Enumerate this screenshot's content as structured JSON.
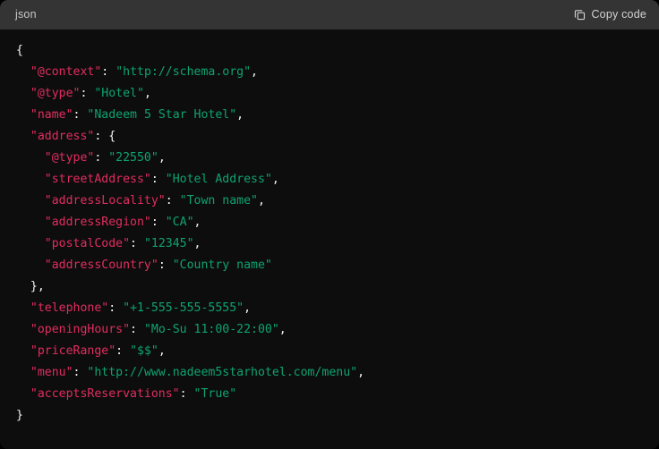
{
  "header": {
    "language_label": "json",
    "copy_label": "Copy code",
    "copy_icon": "copy-code-icon"
  },
  "theme": {
    "header_bg": "#343434",
    "body_bg": "#0d0d0d",
    "punctuation_color": "#f5f5f5",
    "key_color": "#e12d5f",
    "string_color": "#0ea371",
    "label_color": "#c8c8c8"
  },
  "code": {
    "language": "json",
    "lines": [
      {
        "indent": 0,
        "parts": [
          {
            "t": "punc",
            "v": "{"
          }
        ]
      },
      {
        "indent": 1,
        "parts": [
          {
            "t": "key",
            "v": "\"@context\""
          },
          {
            "t": "punc",
            "v": ": "
          },
          {
            "t": "str",
            "v": "\"http://schema.org\""
          },
          {
            "t": "punc",
            "v": ","
          }
        ]
      },
      {
        "indent": 1,
        "parts": [
          {
            "t": "key",
            "v": "\"@type\""
          },
          {
            "t": "punc",
            "v": ": "
          },
          {
            "t": "str",
            "v": "\"Hotel\""
          },
          {
            "t": "punc",
            "v": ","
          }
        ]
      },
      {
        "indent": 1,
        "parts": [
          {
            "t": "key",
            "v": "\"name\""
          },
          {
            "t": "punc",
            "v": ": "
          },
          {
            "t": "str",
            "v": "\"Nadeem 5 Star Hotel\""
          },
          {
            "t": "punc",
            "v": ","
          }
        ]
      },
      {
        "indent": 1,
        "parts": [
          {
            "t": "key",
            "v": "\"address\""
          },
          {
            "t": "punc",
            "v": ": {"
          }
        ]
      },
      {
        "indent": 2,
        "parts": [
          {
            "t": "key",
            "v": "\"@type\""
          },
          {
            "t": "punc",
            "v": ": "
          },
          {
            "t": "str",
            "v": "\"22550\""
          },
          {
            "t": "punc",
            "v": ","
          }
        ]
      },
      {
        "indent": 2,
        "parts": [
          {
            "t": "key",
            "v": "\"streetAddress\""
          },
          {
            "t": "punc",
            "v": ": "
          },
          {
            "t": "str",
            "v": "\"Hotel Address\""
          },
          {
            "t": "punc",
            "v": ","
          }
        ]
      },
      {
        "indent": 2,
        "parts": [
          {
            "t": "key",
            "v": "\"addressLocality\""
          },
          {
            "t": "punc",
            "v": ": "
          },
          {
            "t": "str",
            "v": "\"Town name\""
          },
          {
            "t": "punc",
            "v": ","
          }
        ]
      },
      {
        "indent": 2,
        "parts": [
          {
            "t": "key",
            "v": "\"addressRegion\""
          },
          {
            "t": "punc",
            "v": ": "
          },
          {
            "t": "str",
            "v": "\"CA\""
          },
          {
            "t": "punc",
            "v": ","
          }
        ]
      },
      {
        "indent": 2,
        "parts": [
          {
            "t": "key",
            "v": "\"postalCode\""
          },
          {
            "t": "punc",
            "v": ": "
          },
          {
            "t": "str",
            "v": "\"12345\""
          },
          {
            "t": "punc",
            "v": ","
          }
        ]
      },
      {
        "indent": 2,
        "parts": [
          {
            "t": "key",
            "v": "\"addressCountry\""
          },
          {
            "t": "punc",
            "v": ": "
          },
          {
            "t": "str",
            "v": "\"Country name\""
          }
        ]
      },
      {
        "indent": 1,
        "parts": [
          {
            "t": "punc",
            "v": "},"
          }
        ]
      },
      {
        "indent": 1,
        "parts": [
          {
            "t": "key",
            "v": "\"telephone\""
          },
          {
            "t": "punc",
            "v": ": "
          },
          {
            "t": "str",
            "v": "\"+1-555-555-5555\""
          },
          {
            "t": "punc",
            "v": ","
          }
        ]
      },
      {
        "indent": 1,
        "parts": [
          {
            "t": "key",
            "v": "\"openingHours\""
          },
          {
            "t": "punc",
            "v": ": "
          },
          {
            "t": "str",
            "v": "\"Mo-Su 11:00-22:00\""
          },
          {
            "t": "punc",
            "v": ","
          }
        ]
      },
      {
        "indent": 1,
        "parts": [
          {
            "t": "key",
            "v": "\"priceRange\""
          },
          {
            "t": "punc",
            "v": ": "
          },
          {
            "t": "str",
            "v": "\"$$\""
          },
          {
            "t": "punc",
            "v": ","
          }
        ]
      },
      {
        "indent": 1,
        "parts": [
          {
            "t": "key",
            "v": "\"menu\""
          },
          {
            "t": "punc",
            "v": ": "
          },
          {
            "t": "str",
            "v": "\"http://www.nadeem5starhotel.com/menu\""
          },
          {
            "t": "punc",
            "v": ","
          }
        ]
      },
      {
        "indent": 1,
        "parts": [
          {
            "t": "key",
            "v": "\"acceptsReservations\""
          },
          {
            "t": "punc",
            "v": ": "
          },
          {
            "t": "str",
            "v": "\"True\""
          }
        ]
      },
      {
        "indent": 0,
        "parts": [
          {
            "t": "punc",
            "v": "}"
          }
        ]
      }
    ]
  }
}
